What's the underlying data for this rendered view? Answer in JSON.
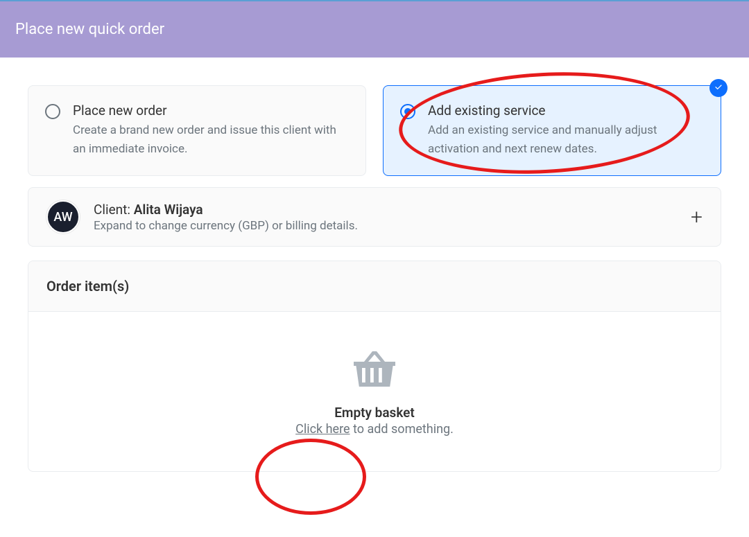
{
  "header": {
    "title": "Place new quick order"
  },
  "options": {
    "new_order": {
      "title": "Place new order",
      "desc": "Create a brand new order and issue this client with an immediate invoice."
    },
    "existing": {
      "title": "Add existing service",
      "desc": "Add an existing service and manually adjust activation and next renew dates."
    }
  },
  "client": {
    "initials": "AW",
    "label": "Client: ",
    "name": "Alita Wijaya",
    "hint": "Expand to change currency (GBP) or billing details."
  },
  "order_section": {
    "heading": "Order item(s)",
    "empty_title": "Empty basket",
    "click_here": "Click here",
    "empty_suffix": " to add something."
  }
}
